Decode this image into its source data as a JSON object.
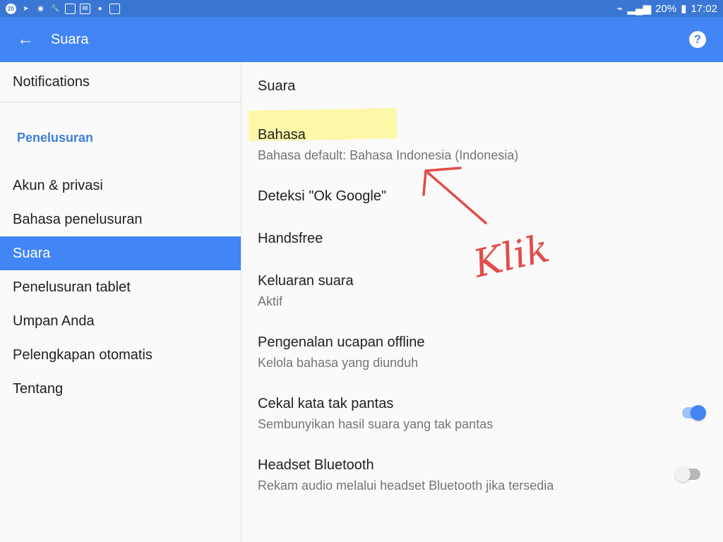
{
  "status": {
    "left_icons": [
      "20",
      "telegram",
      "whatsapp",
      "wrench",
      "image",
      "mail",
      "lock",
      "image"
    ],
    "battery": "20%",
    "time": "17:02"
  },
  "appbar": {
    "title": "Suara",
    "back_icon": "←",
    "help_icon": "?"
  },
  "sidebar": {
    "notifications": "Notifications",
    "section_label": "Penelusuran",
    "items": [
      {
        "label": "Akun & privasi"
      },
      {
        "label": "Bahasa penelusuran"
      },
      {
        "label": "Suara"
      },
      {
        "label": "Penelusuran tablet"
      },
      {
        "label": "Umpan Anda"
      },
      {
        "label": "Pelengkapan otomatis"
      },
      {
        "label": "Tentang"
      }
    ]
  },
  "content": {
    "title": "Suara",
    "settings": [
      {
        "title": "Bahasa",
        "subtitle": "Bahasa default: Bahasa Indonesia (Indonesia)"
      },
      {
        "title": "Deteksi \"Ok Google\"",
        "subtitle": ""
      },
      {
        "title": "Handsfree",
        "subtitle": ""
      },
      {
        "title": "Keluaran suara",
        "subtitle": "Aktif"
      },
      {
        "title": "Pengenalan ucapan offline",
        "subtitle": "Kelola bahasa yang diunduh"
      },
      {
        "title": "Cekal kata tak pantas",
        "subtitle": "Sembunyikan hasil suara yang tak pantas",
        "toggle": true
      },
      {
        "title": "Headset Bluetooth",
        "subtitle": "Rekam audio melalui headset Bluetooth jika tersedia",
        "toggle": false
      }
    ]
  },
  "annotation": {
    "text": "Klik",
    "color": "#e34b47"
  },
  "colors": {
    "accent": "#4285f4",
    "highlight": "#fff564"
  }
}
